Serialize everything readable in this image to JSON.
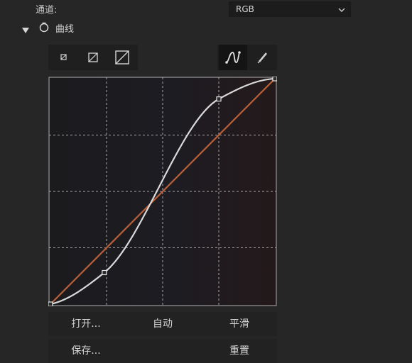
{
  "channel": {
    "label": "通道:",
    "value": "RGB"
  },
  "curves_section": {
    "title": "曲线",
    "expanded": true
  },
  "toolbar": {
    "left_tools": [
      "curve-preview-small-icon",
      "curve-preview-medium-icon",
      "curve-preview-large-icon"
    ],
    "right_tools": [
      "curve-edit-icon",
      "pencil-draw-icon"
    ],
    "active_right_tool": "curve-edit-icon"
  },
  "graph": {
    "grid_divisions": 4,
    "diagonal_color": "#b9603a",
    "curve_color": "#d9d9d9",
    "control_points": [
      {
        "input": 0,
        "output": 0
      },
      {
        "input": 0.24,
        "output": 0.14
      },
      {
        "input": 0.75,
        "output": 0.91
      },
      {
        "input": 1,
        "output": 1
      }
    ]
  },
  "actions": {
    "open": "打开...",
    "auto": "自动",
    "smooth": "平滑",
    "save": "保存...",
    "reset": "重置"
  }
}
